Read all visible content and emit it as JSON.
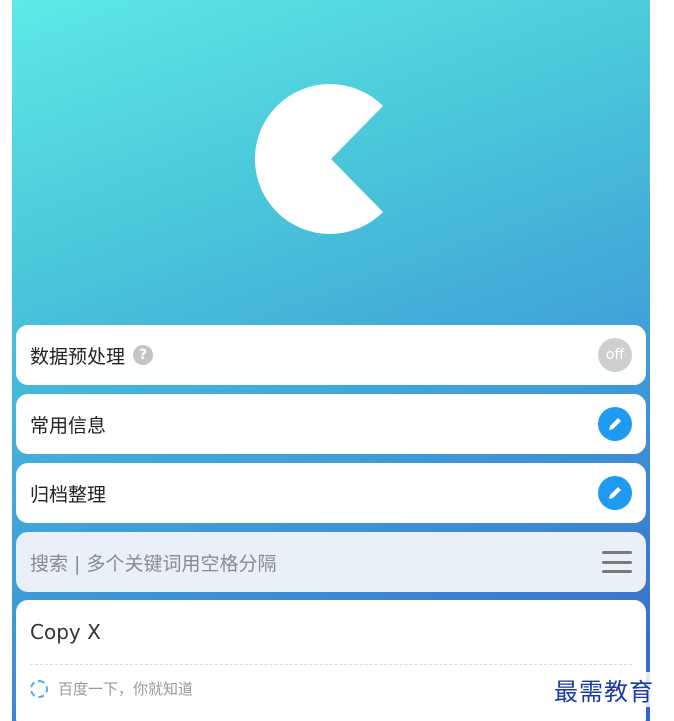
{
  "rows": {
    "preprocess": {
      "label": "数据预处理",
      "help_icon": "?",
      "toggle_label": "off"
    },
    "common_info": {
      "label": "常用信息"
    },
    "archive": {
      "label": "归档整理"
    }
  },
  "search": {
    "placeholder": "搜索 | 多个关键词用空格分隔"
  },
  "panel": {
    "copy_label": "Copy X",
    "baidu_hint": "百度一下，你就知道"
  },
  "watermark": "最需教育",
  "colors": {
    "gradient_start": "#5ee9e6",
    "gradient_end": "#3a62cc",
    "edit_button": "#1e9bf0",
    "toggle_off": "#cfcfcf"
  },
  "icons": {
    "logo": "pacman-logo",
    "help": "question-icon",
    "edit": "pencil-icon",
    "menu": "hamburger-icon",
    "spinner": "loading-circle-icon"
  }
}
